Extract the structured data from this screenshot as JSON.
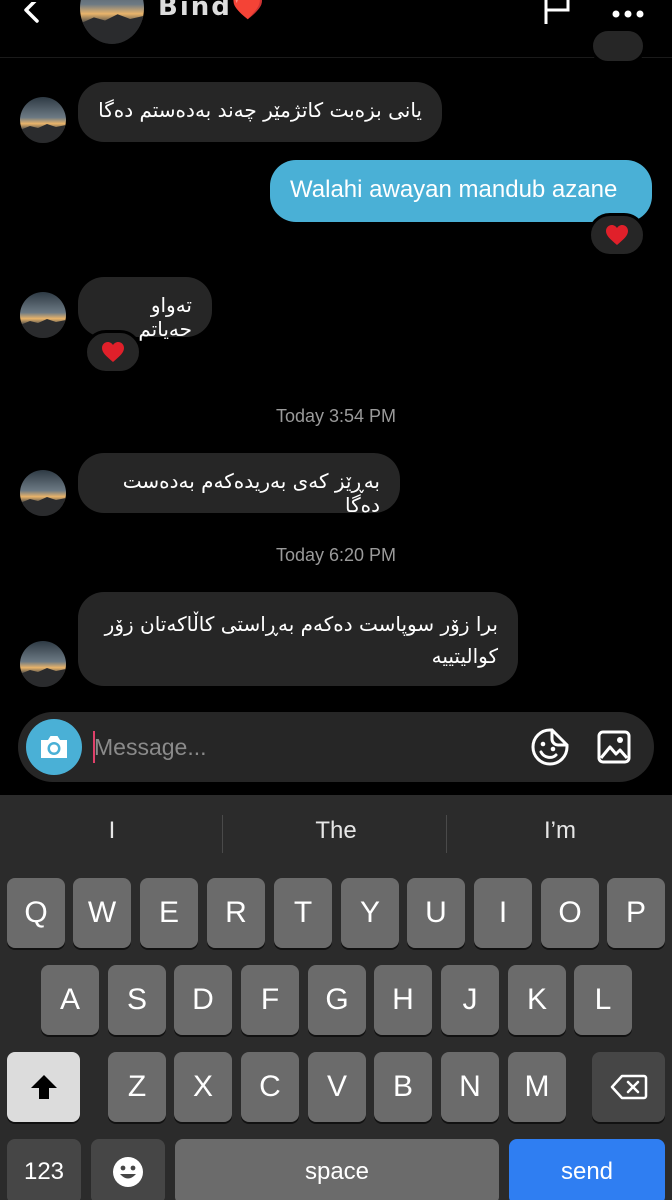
{
  "header": {
    "name": "Bind",
    "name_emoji": "❤️",
    "back_icon": "chevron-left-icon",
    "flag_icon": "flag-icon",
    "more_icon": "more-dots-icon"
  },
  "messages": [
    {
      "side": "in",
      "text": "یانی بزەبت کاتژمێر چەند بەدەستم دەگا"
    },
    {
      "side": "out",
      "text": "Walahi awayan mandub azane",
      "reaction": "❤️"
    },
    {
      "side": "in",
      "text": "تەواو حەیاتم",
      "reaction": "❤️"
    },
    {
      "side": "timestamp",
      "text": "Today 3:54 PM"
    },
    {
      "side": "in",
      "text": "بەڕێز کەی بەریدەکەم بەدەست دەگا"
    },
    {
      "side": "timestamp",
      "text": "Today 6:20 PM"
    },
    {
      "side": "in",
      "text": "برا زۆر سوپاست دەکەم بەڕاستی کاڵاکەتان زۆر کوالیتییە"
    }
  ],
  "composer": {
    "placeholder": "Message...",
    "value": "",
    "camera_icon": "camera-icon",
    "sticker_icon": "sticker-icon",
    "gallery_icon": "gallery-icon"
  },
  "keyboard": {
    "suggestions": [
      "I",
      "The",
      "I’m"
    ],
    "row1": [
      "Q",
      "W",
      "E",
      "R",
      "T",
      "Y",
      "U",
      "I",
      "O",
      "P"
    ],
    "row2": [
      "A",
      "S",
      "D",
      "F",
      "G",
      "H",
      "J",
      "K",
      "L"
    ],
    "row3": [
      "Z",
      "X",
      "C",
      "V",
      "B",
      "N",
      "M"
    ],
    "numbers_label": "123",
    "space_label": "space",
    "send_label": "send",
    "shift_icon": "shift-icon",
    "backspace_icon": "backspace-icon",
    "emoji_icon": "emoji-icon"
  },
  "colors": {
    "outgoing_bubble": "#4ab0d6",
    "incoming_bubble": "#262626",
    "send_key": "#2f7ef2",
    "heart": "#e0202a"
  }
}
